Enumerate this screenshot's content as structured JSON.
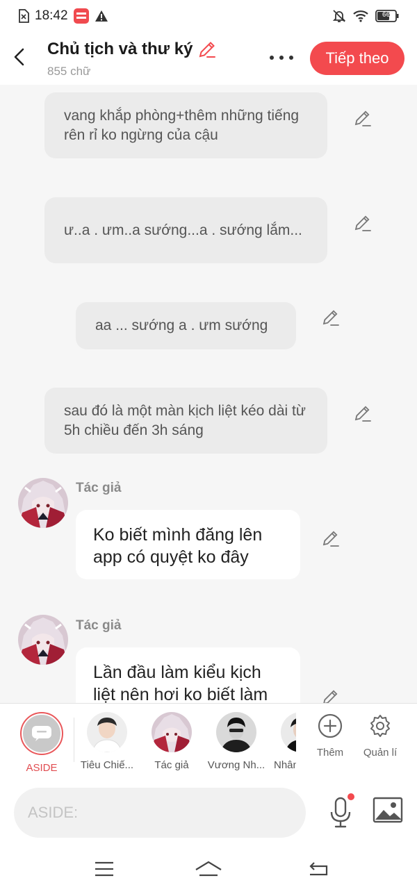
{
  "status_bar": {
    "time": "18:42",
    "left_icons": [
      "sim-off-icon",
      "mangatoon-app-icon",
      "warning-icon"
    ],
    "right_icons": [
      "bell-off-icon",
      "wifi-icon",
      "battery-icon"
    ],
    "battery_level": "66"
  },
  "header": {
    "title": "Chủ tịch và thư ký",
    "subtitle": "855 chữ",
    "next_label": "Tiếp theo",
    "accent_color": "#f34a4e"
  },
  "messages": [
    {
      "type": "aside",
      "text": "vang khắp phòng+thêm những tiếng rên rỉ ko ngừng của cậu"
    },
    {
      "type": "aside",
      "text": "ư..a . ưm..a sướng...a . sướng lắm..."
    },
    {
      "type": "aside",
      "text": "aa ... sướng a . ưm sướng"
    },
    {
      "type": "aside",
      "text": "sau đó là một màn kịch liệt kéo dài từ 5h chiều đến 3h sáng"
    },
    {
      "type": "character",
      "name": "Tác giả",
      "text": "Ko biết mình đăng lên app có quyệt ko đây"
    },
    {
      "type": "character",
      "name": "Tác giả",
      "text": "Lần đầu làm kiểu kịch liệt nên hơi ko biết làm"
    }
  ],
  "characters": [
    {
      "label": "ASIDE",
      "selected": true
    },
    {
      "label": "Tiêu Chiế..."
    },
    {
      "label": "Tác giả"
    },
    {
      "label": "Vương Nh..."
    },
    {
      "label": "Nhân"
    }
  ],
  "tools": {
    "add_label": "Thêm",
    "manage_label": "Quản lí"
  },
  "input": {
    "placeholder": "ASIDE:"
  }
}
